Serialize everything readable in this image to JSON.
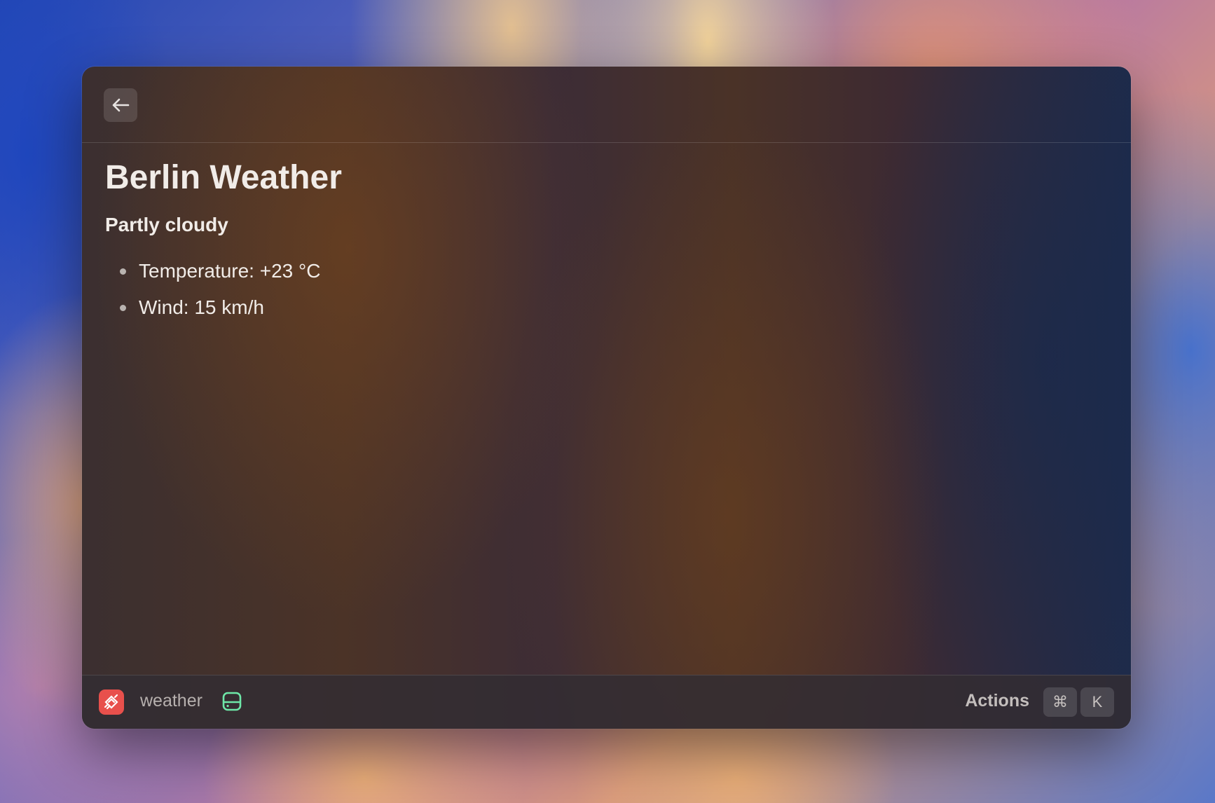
{
  "window": {
    "back_button_icon": "arrow-left-icon"
  },
  "content": {
    "title": "Berlin Weather",
    "condition": "Partly cloudy",
    "details": [
      "Temperature: +23 °C",
      "Wind: 15 km/h"
    ]
  },
  "footer": {
    "extension_icon": "weather-extension-icon",
    "extension_name": "weather",
    "status_icon": "drive-icon",
    "actions_label": "Actions",
    "shortcut_keys": [
      "⌘",
      "K"
    ]
  },
  "colors": {
    "extension_icon_bg": "#e8504c",
    "status_icon": "#6ee7a8",
    "text_primary": "#f1ece8",
    "text_secondary": "#b6b0ae"
  }
}
